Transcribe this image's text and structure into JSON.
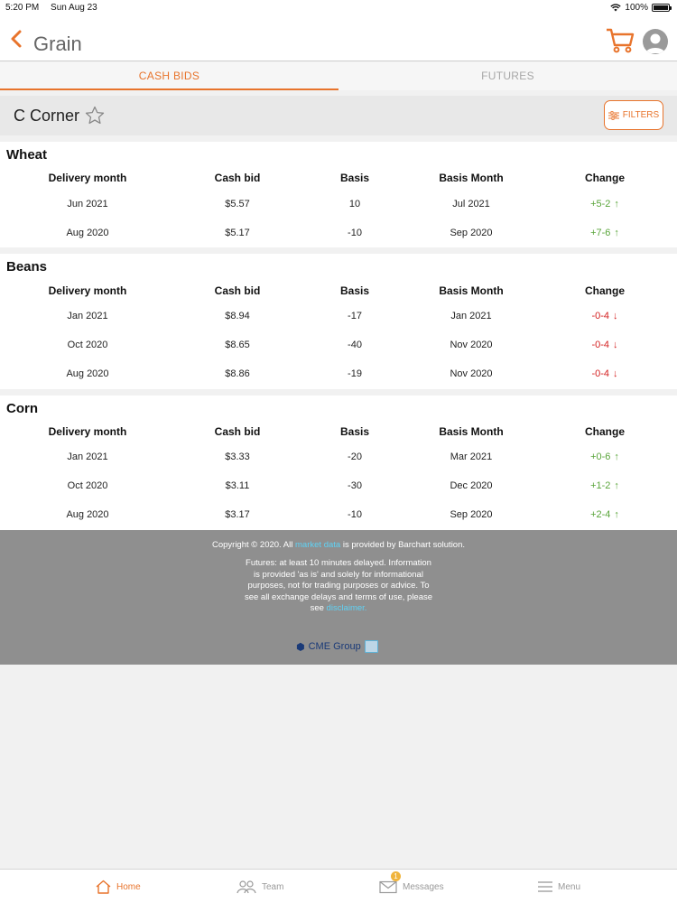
{
  "status_bar": {
    "time": "5:20 PM",
    "date": "Sun Aug 23",
    "battery": "100%"
  },
  "header": {
    "title": "Grain"
  },
  "tabs": [
    {
      "label": "CASH BIDS"
    },
    {
      "label": "FUTURES"
    }
  ],
  "location": {
    "name": "C Corner",
    "filters_label": "FILTERS"
  },
  "columns": [
    "Delivery month",
    "Cash bid",
    "Basis",
    "Basis Month",
    "Change"
  ],
  "sections": [
    {
      "title": "Wheat",
      "rows": [
        {
          "month": "Jun 2021",
          "cash_bid": "$5.57",
          "basis": "10",
          "basis_month": "Jul 2021",
          "change": "+5-2",
          "dir": "up"
        },
        {
          "month": "Aug 2020",
          "cash_bid": "$5.17",
          "basis": "-10",
          "basis_month": "Sep 2020",
          "change": "+7-6",
          "dir": "up"
        }
      ]
    },
    {
      "title": "Beans",
      "rows": [
        {
          "month": "Jan 2021",
          "cash_bid": "$8.94",
          "basis": "-17",
          "basis_month": "Jan 2021",
          "change": "-0-4",
          "dir": "down"
        },
        {
          "month": "Oct 2020",
          "cash_bid": "$8.65",
          "basis": "-40",
          "basis_month": "Nov 2020",
          "change": "-0-4",
          "dir": "down"
        },
        {
          "month": "Aug 2020",
          "cash_bid": "$8.86",
          "basis": "-19",
          "basis_month": "Nov 2020",
          "change": "-0-4",
          "dir": "down"
        }
      ]
    },
    {
      "title": "Corn",
      "rows": [
        {
          "month": "Jan 2021",
          "cash_bid": "$3.33",
          "basis": "-20",
          "basis_month": "Mar 2021",
          "change": "+0-6",
          "dir": "up"
        },
        {
          "month": "Oct 2020",
          "cash_bid": "$3.11",
          "basis": "-30",
          "basis_month": "Dec 2020",
          "change": "+1-2",
          "dir": "up"
        },
        {
          "month": "Aug 2020",
          "cash_bid": "$3.17",
          "basis": "-10",
          "basis_month": "Sep 2020",
          "change": "+2-4",
          "dir": "up"
        }
      ]
    }
  ],
  "footer": {
    "copyright_pre": "Copyright © 2020. All",
    "copyright_link": "market data",
    "copyright_post": "is provided by Barchart solution.",
    "disclaimer": "Futures: at least 10 minutes delayed. Information is provided 'as is' and solely for informational purposes, not for trading purposes or advice. To see all exchange delays and terms of use, please see",
    "disclaimer_link": "disclaimer.",
    "logo": "CME Group"
  },
  "tabbar": {
    "home": "Home",
    "team": "Team",
    "messages": "Messages",
    "menu": "Menu",
    "messages_badge": "1"
  },
  "colors": {
    "accent": "#e8742c",
    "up": "#5aa53b",
    "down": "#d42121",
    "footer_bg": "#8f8f8f"
  },
  "icons": [
    "back-chevron-icon",
    "cart-icon",
    "avatar-icon",
    "star-icon",
    "sliders-icon",
    "home-icon",
    "team-icon",
    "mail-icon",
    "menu-icon"
  ]
}
